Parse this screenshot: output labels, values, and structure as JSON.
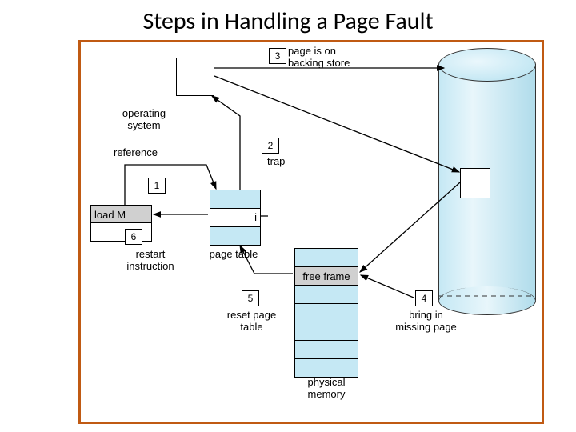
{
  "title": "Steps in Handling a Page Fault",
  "steps": {
    "s1": "1",
    "s2": "2",
    "s3": "3",
    "s4": "4",
    "s5": "5",
    "s6": "6"
  },
  "labels": {
    "page_backing": "page is on\nbacking store",
    "operating_system": "operating\nsystem",
    "reference": "reference",
    "trap": "trap",
    "load_m": "load M",
    "restart": "restart\ninstruction",
    "page_table": "page table",
    "free_frame": "free frame",
    "reset_page": "reset page\ntable",
    "bring_in": "bring in\nmissing page",
    "physical_memory": "physical\nmemory",
    "invalid": "i"
  }
}
